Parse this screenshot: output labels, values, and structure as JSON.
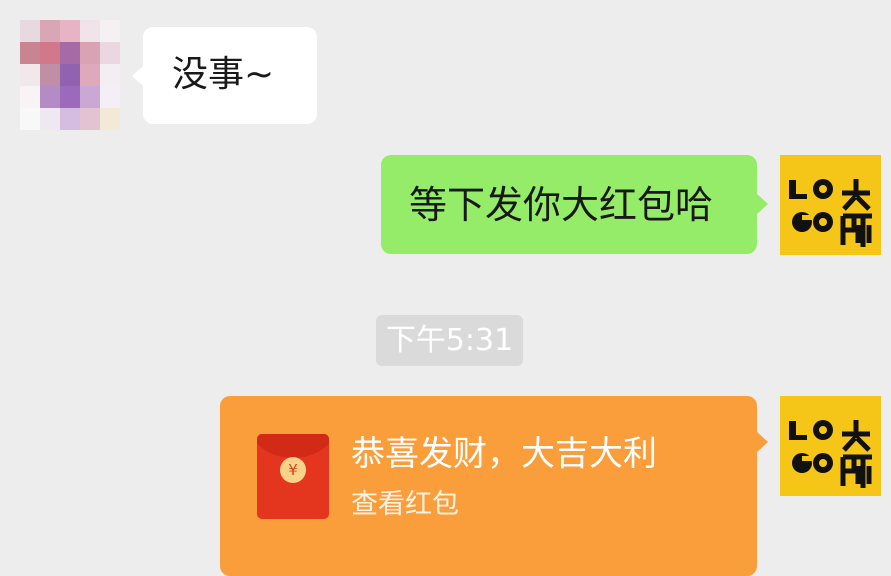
{
  "messages": [
    {
      "side": "left",
      "text": "没事~"
    },
    {
      "side": "right",
      "text": "等下发你大红包哈"
    }
  ],
  "timestamp": "下午5:31",
  "red_packet": {
    "title": "恭喜发财，大吉大利",
    "subtitle": "查看红包",
    "icon": "red-envelope-icon",
    "symbol": "¥"
  },
  "avatars": {
    "contact": "pixelated-avatar",
    "self_logo": {
      "letters_top": "LO",
      "letters_bottom": "GO",
      "chars": "大師"
    }
  },
  "colors": {
    "background": "#ededed",
    "incoming_bubble": "#ffffff",
    "outgoing_bubble": "#95ec69",
    "red_packet_bubble": "#fa9d3b",
    "logo_bg": "#f5c518"
  }
}
